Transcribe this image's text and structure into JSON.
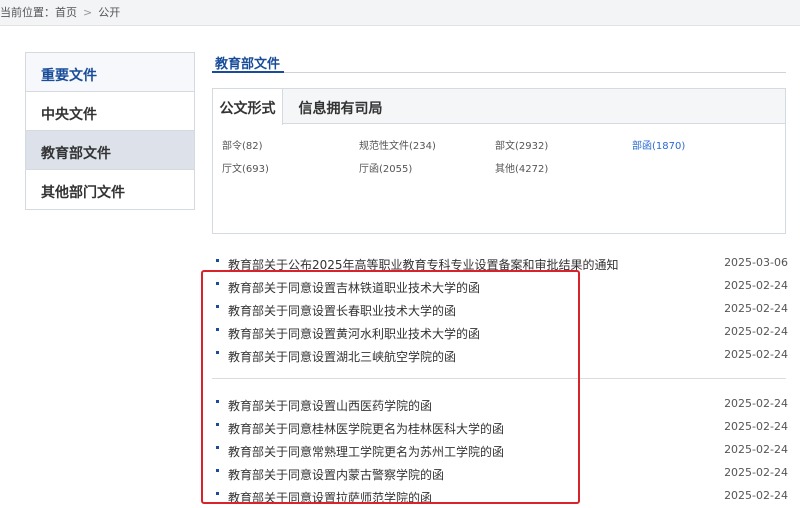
{
  "breadcrumb": {
    "prefix": "当前位置：",
    "home": "首页",
    "current": "公开",
    "separator": ">"
  },
  "sidebar": {
    "items": [
      {
        "label": "重要文件"
      },
      {
        "label": "中央文件"
      },
      {
        "label": "教育部文件"
      },
      {
        "label": "其他部门文件"
      }
    ]
  },
  "section": {
    "title": "教育部文件"
  },
  "tabs": [
    {
      "label": "公文形式"
    },
    {
      "label": "信息拥有司局"
    }
  ],
  "categories": [
    {
      "label": "部令(82)"
    },
    {
      "label": "规范性文件(234)"
    },
    {
      "label": "部文(2932)"
    },
    {
      "label": "部函(1870)"
    },
    {
      "label": "厅文(693)"
    },
    {
      "label": "厅函(2055)"
    },
    {
      "label": "其他(4272)"
    }
  ],
  "documents": [
    {
      "title": "教育部关于公布2025年高等职业教育专科专业设置备案和审批结果的通知",
      "date": "2025-03-06"
    },
    {
      "title": "教育部关于同意设置吉林铁道职业技术大学的函",
      "date": "2025-02-24"
    },
    {
      "title": "教育部关于同意设置长春职业技术大学的函",
      "date": "2025-02-24"
    },
    {
      "title": "教育部关于同意设置黄河水利职业技术大学的函",
      "date": "2025-02-24"
    },
    {
      "title": "教育部关于同意设置湖北三峡航空学院的函",
      "date": "2025-02-24"
    },
    {
      "title": "教育部关于同意设置山西医药学院的函",
      "date": "2025-02-24"
    },
    {
      "title": "教育部关于同意桂林医学院更名为桂林医科大学的函",
      "date": "2025-02-24"
    },
    {
      "title": "教育部关于同意常熟理工学院更名为苏州工学院的函",
      "date": "2025-02-24"
    },
    {
      "title": "教育部关于同意设置内蒙古警察学院的函",
      "date": "2025-02-24"
    },
    {
      "title": "教育部关于同意设置拉萨师范学院的函",
      "date": "2025-02-24"
    }
  ],
  "colors": {
    "accent": "#1a4d99",
    "highlight_box": "#d9232a",
    "selected_category": "#2a6bd0"
  }
}
